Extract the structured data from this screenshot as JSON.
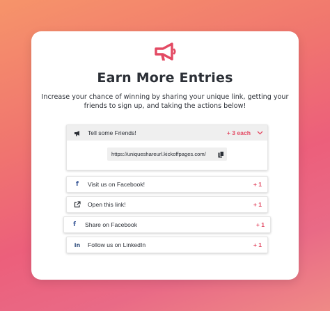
{
  "header": {
    "icon": "megaphone-icon",
    "title": "Earn More Entries",
    "subtitle": "Increase your chance of winning by sharing your unique link, getting your friends to sign up, and taking the actions below!"
  },
  "colors": {
    "accent": "#e34a63",
    "text": "#2b2f36",
    "facebook": "#3b5998"
  },
  "entries": [
    {
      "icon": "megaphone-icon",
      "label": "Tell some Friends!",
      "points": "+ 3 each",
      "expanded": true,
      "share_url": "https://uniqueshareurl.kickoffpages.com/"
    },
    {
      "icon": "facebook-icon",
      "label": "Visit us on Facebook!",
      "points": "+ 1"
    },
    {
      "icon": "external-link-icon",
      "label": "Open this link!",
      "points": "+ 1"
    },
    {
      "icon": "facebook-icon",
      "label": "Share on Facebook",
      "points": "+ 1"
    },
    {
      "icon": "linkedin-icon",
      "label": "Follow us on LinkedIn",
      "points": "+ 1"
    }
  ]
}
